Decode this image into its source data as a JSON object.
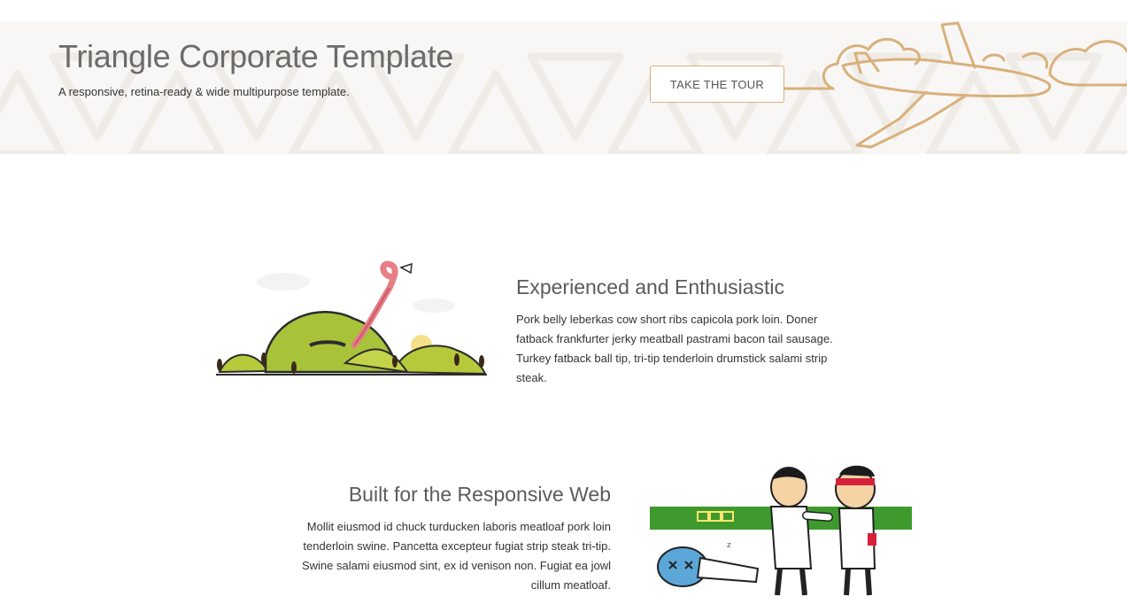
{
  "hero": {
    "title": "Triangle Corporate Template",
    "subtitle": "A responsive, retina-ready & wide multipurpose template.",
    "cta_label": "TAKE THE TOUR",
    "accent_color": "#d9b07c",
    "background_color": "#f8f7f5"
  },
  "features": [
    {
      "title": "Experienced and Enthusiastic",
      "body": "Pork belly leberkas cow short ribs capicola pork loin. Doner fatback frankfurter jerky meatball pastrami bacon tail sausage. Turkey fatback ball tip, tri-tip tenderloin drumstick salami strip steak.",
      "illustration": "worm-in-hills-illustration"
    },
    {
      "title": "Built for the Responsive Web",
      "body": "Mollit eiusmod id chuck turducken laboris meatloaf pork loin tenderloin swine. Pancetta excepteur fugiat strip steak tri-tip. Swine salami eiusmod sint, ex id venison non. Fugiat ea jowl cillum meatloaf.",
      "illustration": "martial-arts-fighters-illustration"
    }
  ]
}
